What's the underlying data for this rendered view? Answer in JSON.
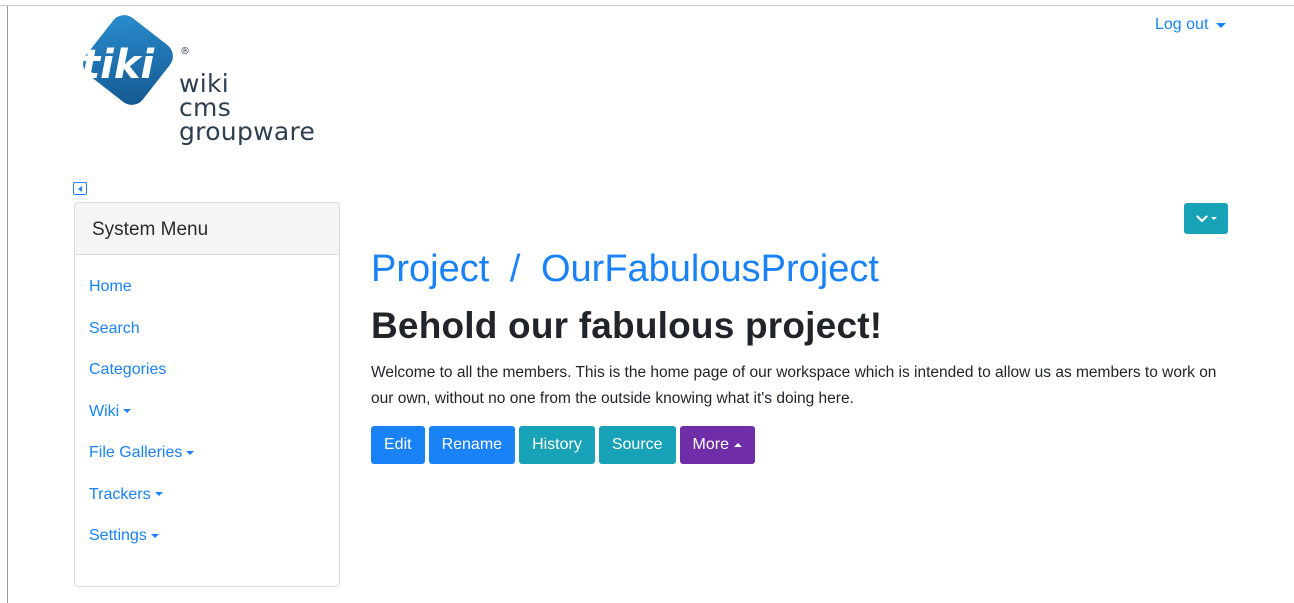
{
  "logo": {
    "mark_text": "tiki",
    "registered": "®",
    "words": [
      "wiki",
      "cms",
      "groupware"
    ]
  },
  "header": {
    "logout_label": "Log out"
  },
  "sidebar": {
    "title": "System Menu",
    "items": [
      {
        "label": "Home",
        "has_dropdown": false
      },
      {
        "label": "Search",
        "has_dropdown": false
      },
      {
        "label": "Categories",
        "has_dropdown": false
      },
      {
        "label": "Wiki",
        "has_dropdown": true
      },
      {
        "label": "File Galleries",
        "has_dropdown": true
      },
      {
        "label": "Trackers",
        "has_dropdown": true
      },
      {
        "label": "Settings",
        "has_dropdown": true
      }
    ]
  },
  "page": {
    "breadcrumb_parent": "Project",
    "breadcrumb_separator": "/",
    "breadcrumb_current": "OurFabulousProject",
    "heading": "Behold our fabulous project!",
    "intro": "Welcome to all the members. This is the home page of our workspace which is intended to allow us as members to work on our own, without no one from the outside knowing what it's doing here."
  },
  "actions": {
    "edit": "Edit",
    "rename": "Rename",
    "history": "History",
    "source": "Source",
    "more": "More"
  },
  "colors": {
    "link": "#1a82f7",
    "primary": "#1a82f7",
    "info": "#17a2b8",
    "purple": "#6f2da8",
    "logo_blue": "#1d6fae"
  },
  "icons": {
    "collapse_toggle": "sidebar-collapse-icon",
    "page_options": "chevron-down-icon"
  }
}
